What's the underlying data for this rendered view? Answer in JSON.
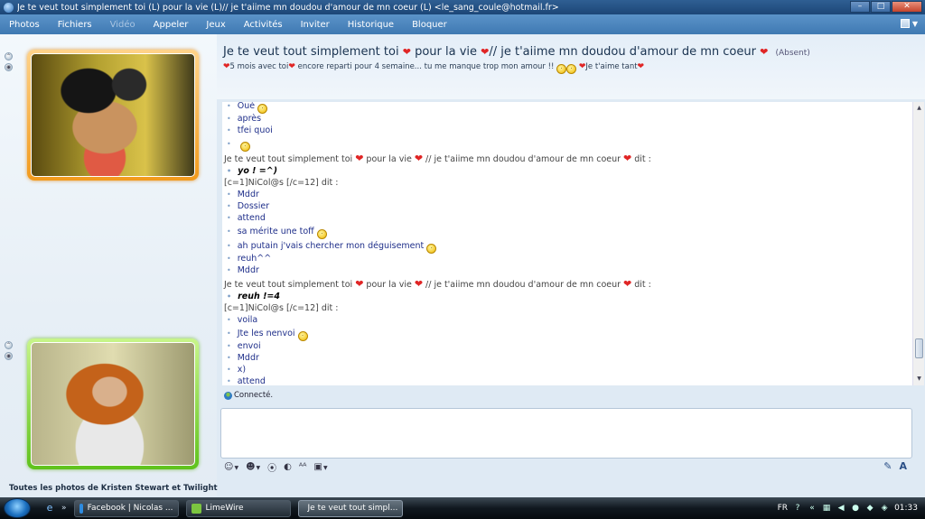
{
  "window": {
    "title": "Je te veut tout simplement toi (L) pour la vie (L)// je t'aiime mn doudou d'amour de mn coeur (L) <le_sang_coule@hotmail.fr>",
    "min": "–",
    "max": "□",
    "close": "✕"
  },
  "menu": {
    "items": [
      "Photos",
      "Fichiers",
      "Vidéo",
      "Appeler",
      "Jeux",
      "Activités",
      "Inviter",
      "Historique",
      "Bloquer"
    ]
  },
  "contact": {
    "name_parts": [
      "Je te veut tout simplement toi",
      "pour la vie",
      "// je t'aiime mn doudou d'amour de mn coeur"
    ],
    "status": "(Absent)",
    "message_parts": [
      "5 mois avec toi",
      "encore reparti pour 4 semaine... tu me manque trop mon amour !!",
      "Je t'aime tant"
    ]
  },
  "conversation": {
    "sender_a": [
      "Je te veut tout simplement toi",
      "pour la vie",
      "// je t'aiime mn doudou d'amour de mn coeur",
      "dit :"
    ],
    "sender_b": "[c=1]NiCol@s [/c=12] dit :",
    "lines": [
      {
        "type": "msg",
        "text": "Oué"
      },
      {
        "type": "msg",
        "text": "après"
      },
      {
        "type": "msg",
        "text": "tfei quoi"
      },
      {
        "type": "msg",
        "text": ""
      },
      {
        "type": "a"
      },
      {
        "type": "bold",
        "text": "yo ! =^)"
      },
      {
        "type": "b"
      },
      {
        "type": "msg",
        "text": "Mddr"
      },
      {
        "type": "msg",
        "text": "Dossier"
      },
      {
        "type": "msg",
        "text": "attend"
      },
      {
        "type": "msg",
        "text": "sa mérite une toff"
      },
      {
        "type": "msg",
        "text": "ah putain j'vais chercher mon déguisement"
      },
      {
        "type": "msg",
        "text": "reuh^^"
      },
      {
        "type": "msg",
        "text": "Mddr"
      },
      {
        "type": "a"
      },
      {
        "type": "bold",
        "text": "reuh !=4"
      },
      {
        "type": "b"
      },
      {
        "type": "msg",
        "text": "voila"
      },
      {
        "type": "msg",
        "text": "Jte les nenvoi"
      },
      {
        "type": "msg",
        "text": "envoi"
      },
      {
        "type": "msg",
        "text": "Mddr"
      },
      {
        "type": "msg",
        "text": "x)"
      },
      {
        "type": "msg",
        "text": "attend"
      }
    ]
  },
  "status_text": "Connecté.",
  "promo": "Toutes les photos de Kristen Stewart et Twilight",
  "taskbar": {
    "tasks": [
      "Facebook | Nicolas ...",
      "LimeWire",
      "Je te veut tout simpl..."
    ],
    "language": "FR",
    "clock": "01:33"
  },
  "colors": {
    "title_bar": "#1c4677",
    "menu_bar": "#3f79b2",
    "frame_top": "#f29a1c",
    "frame_bottom": "#5fc21c",
    "heart": "#e02525"
  }
}
